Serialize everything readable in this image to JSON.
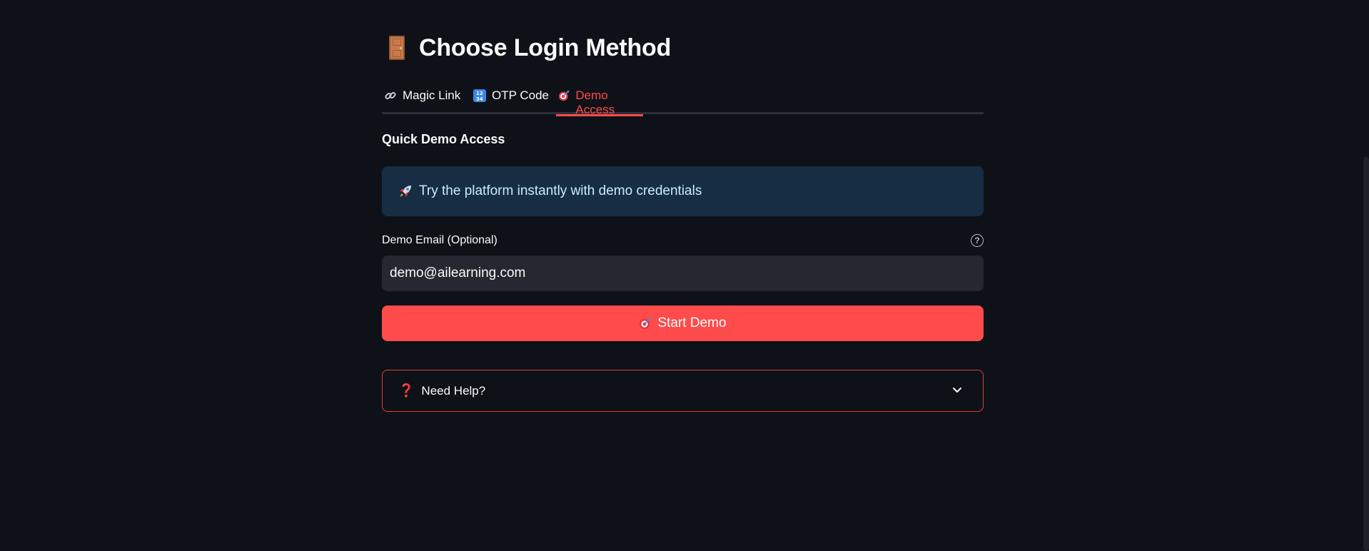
{
  "page": {
    "title": "Choose Login Method",
    "title_icon": "door-icon"
  },
  "tabs": [
    {
      "label": "Magic Link",
      "icon": "link-icon",
      "active": false
    },
    {
      "label": "OTP Code",
      "icon": "input-numbers-icon",
      "active": false
    },
    {
      "label": "Demo Access",
      "icon": "target-icon",
      "active": true
    }
  ],
  "section": {
    "title": "Quick Demo Access"
  },
  "info": {
    "icon": "rocket-icon",
    "text": "Try the platform instantly with demo credentials"
  },
  "email_field": {
    "label": "Demo Email (Optional)",
    "value": "demo@ailearning.com",
    "help_icon": "question-circle-icon"
  },
  "start_button": {
    "label": "Start Demo",
    "icon": "target-icon"
  },
  "help_expander": {
    "icon": "question-mark-icon",
    "label": "Need Help?",
    "chevron": "chevron-down-icon"
  },
  "colors": {
    "background": "#0e1117",
    "accent": "#ff4b4b",
    "info_bg": "#172d43",
    "info_text": "#c7ebff",
    "input_bg": "#262730"
  }
}
